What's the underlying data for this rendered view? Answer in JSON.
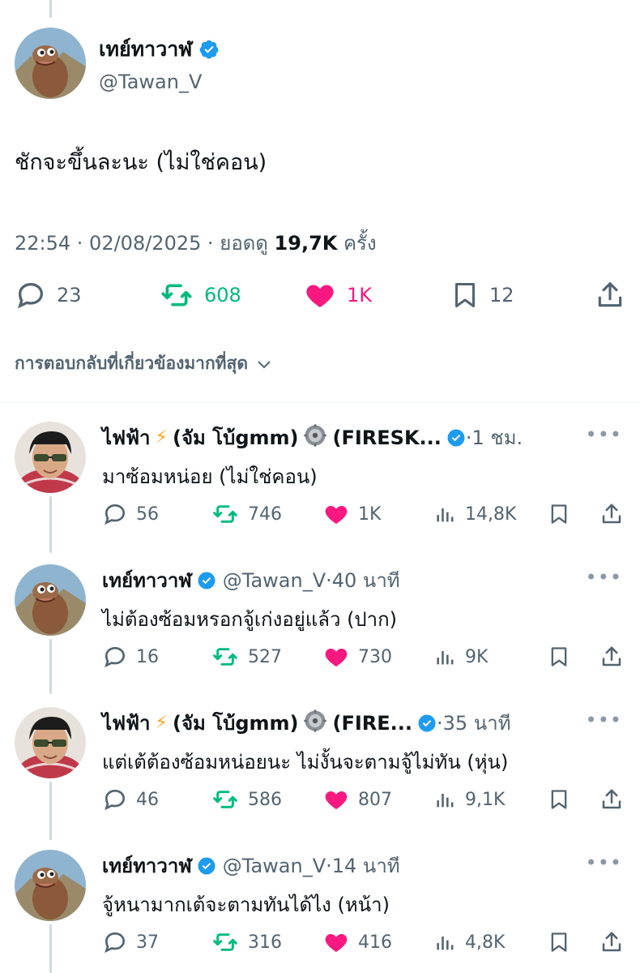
{
  "main_tweet": {
    "display_name": "เทย์ทาวาฬ",
    "handle": "@Tawan_V",
    "text": "ชักจะขึ้นละนะ (ไม่ใช่คอน)",
    "time": "22:54 · 02/08/2025 · ยอดดู ",
    "views": "19,7K",
    "views_suffix": " ครั้ง",
    "replies": "23",
    "retweets": "608",
    "likes": "1K",
    "bookmarks": "12"
  },
  "sort_label": "การตอบกลับที่เกี่ยวข้องมากที่สุด",
  "colors": {
    "verified": "#1d9bf0",
    "retweet": "#00ba7c",
    "like": "#f91880",
    "muted": "#536471"
  },
  "replies": [
    {
      "name": "ไฟฟ้า",
      "name_mid": "(จัม โบ้gmm)",
      "name_tail": "(FIRESK...",
      "handle": "",
      "time": "·1 ชม.",
      "text": "มาซ้อมหน่อย (ไม่ใช่คอน)",
      "replies": "56",
      "retweets": "746",
      "likes": "1K",
      "views": "14,8K"
    },
    {
      "name": "เทย์ทาวาฬ",
      "handle": "@Tawan_V",
      "time": "·40 นาที",
      "text": "ไม่ต้องซ้อมหรอกจู้เก่งอยู่แล้ว (ปาก)",
      "replies": "16",
      "retweets": "527",
      "likes": "730",
      "views": "9K"
    },
    {
      "name": "ไฟฟ้า",
      "name_mid": "(จัม โบ้gmm)",
      "name_tail": "(FIRE...",
      "handle": "",
      "time": "·35 นาที",
      "text": "แต่เต้ต้องซ้อมหน่อยนะ ไม่งั้นจะตามจู้ไม่ทัน (หุ่น)",
      "replies": "46",
      "retweets": "586",
      "likes": "807",
      "views": "9,1K"
    },
    {
      "name": "เทย์ทาวาฬ",
      "handle": "@Tawan_V",
      "time": "·14 นาที",
      "text": "จู้หนามากเต้จะตามทันได้ไง (หน้า)",
      "replies": "37",
      "retweets": "316",
      "likes": "416",
      "views": "4,8K"
    }
  ]
}
